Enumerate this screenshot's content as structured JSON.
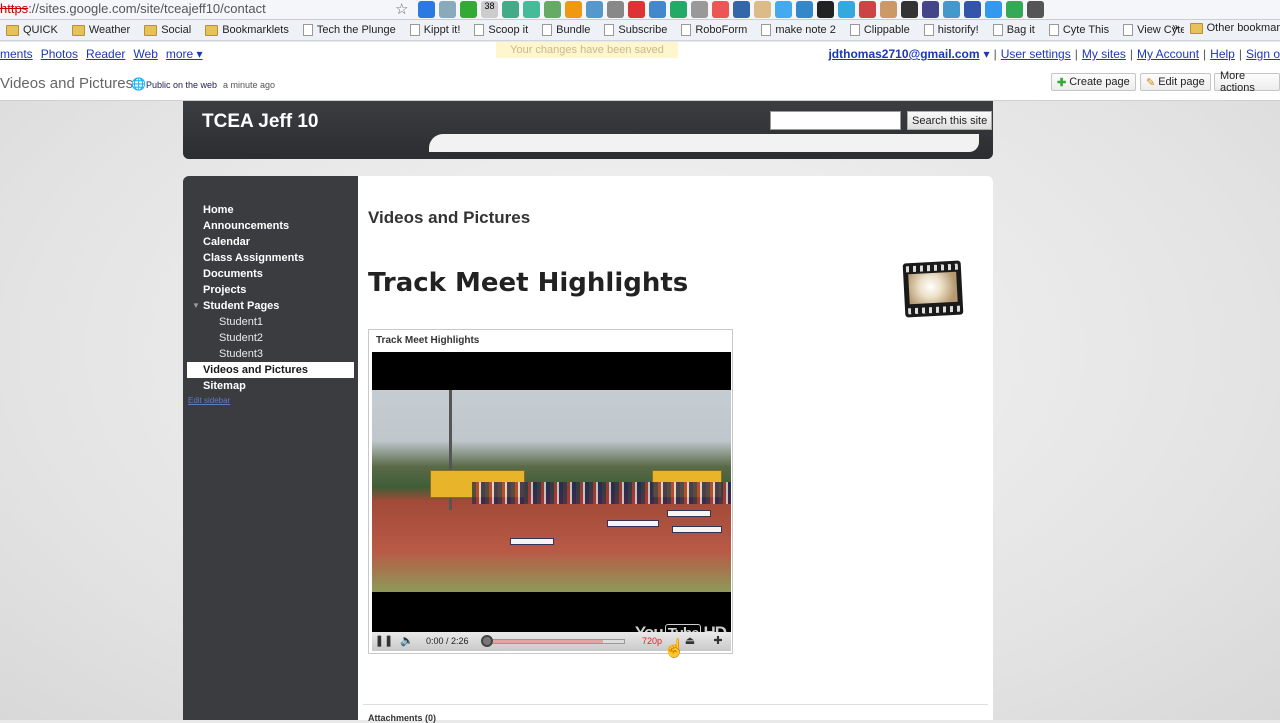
{
  "browser": {
    "url_scheme": "https",
    "url_rest": "://sites.google.com/site/tceajeff10/contact",
    "ext_badge": "38",
    "bookmarks": [
      {
        "label": "QUICK",
        "type": "folder"
      },
      {
        "label": "Weather",
        "type": "folder"
      },
      {
        "label": "Social",
        "type": "folder"
      },
      {
        "label": "Bookmarklets",
        "type": "folder"
      },
      {
        "label": "Tech the Plunge",
        "type": "page"
      },
      {
        "label": "Kippt it!",
        "type": "page"
      },
      {
        "label": "Scoop it",
        "type": "page"
      },
      {
        "label": "Bundle",
        "type": "page"
      },
      {
        "label": "Subscribe",
        "type": "page"
      },
      {
        "label": "RoboForm",
        "type": "page"
      },
      {
        "label": "make note 2",
        "type": "page"
      },
      {
        "label": "Clippable",
        "type": "page"
      },
      {
        "label": "historify!",
        "type": "page"
      },
      {
        "label": "Bag it",
        "type": "page"
      },
      {
        "label": "Cyte This",
        "type": "page"
      },
      {
        "label": "View Cytes",
        "type": "page"
      }
    ],
    "other_bookmarks": "Other bookmar",
    "chevron": "»"
  },
  "gbar": {
    "left_links": [
      "ments",
      "Photos",
      "Reader",
      "Web",
      "more ▾"
    ],
    "email": "jdthomas2710@gmail.com",
    "email_caret": "▾",
    "right_links": [
      "User settings",
      "My sites",
      "My Account",
      "Help",
      "Sign o"
    ],
    "saved_notice": "Your changes have been saved"
  },
  "titlebar": {
    "page_title": "Videos and Pictures",
    "public_label": "Public on the web",
    "ago": "a minute ago",
    "create_page": "Create page",
    "edit_page": "Edit page",
    "more_actions": "More actions"
  },
  "site": {
    "title": "TCEA Jeff 10",
    "search_button": "Search this site",
    "nav": [
      {
        "label": "Home",
        "level": 0
      },
      {
        "label": "Announcements",
        "level": 0
      },
      {
        "label": "Calendar",
        "level": 0
      },
      {
        "label": "Class Assignments",
        "level": 0
      },
      {
        "label": "Documents",
        "level": 0
      },
      {
        "label": "Projects",
        "level": 0
      },
      {
        "label": "Student Pages",
        "level": 0,
        "expanded": true
      },
      {
        "label": "Student1",
        "level": 1
      },
      {
        "label": "Student2",
        "level": 1
      },
      {
        "label": "Student3",
        "level": 1
      },
      {
        "label": "Videos and Pictures",
        "level": 0,
        "active": true
      },
      {
        "label": "Sitemap",
        "level": 0
      }
    ],
    "edit_sidebar": "Edit sidebar"
  },
  "content": {
    "heading": "Videos and Pictures",
    "subheading": "Track Meet Highlights",
    "gadget_title": "Track Meet Highlights",
    "video": {
      "time": "0:00 / 2:26",
      "quality": "720p",
      "logo_text": "You",
      "logo_tube": "Tube",
      "logo_hd": "HD",
      "progress_buffered": 0.85
    },
    "attachments": "Attachments (0)"
  }
}
